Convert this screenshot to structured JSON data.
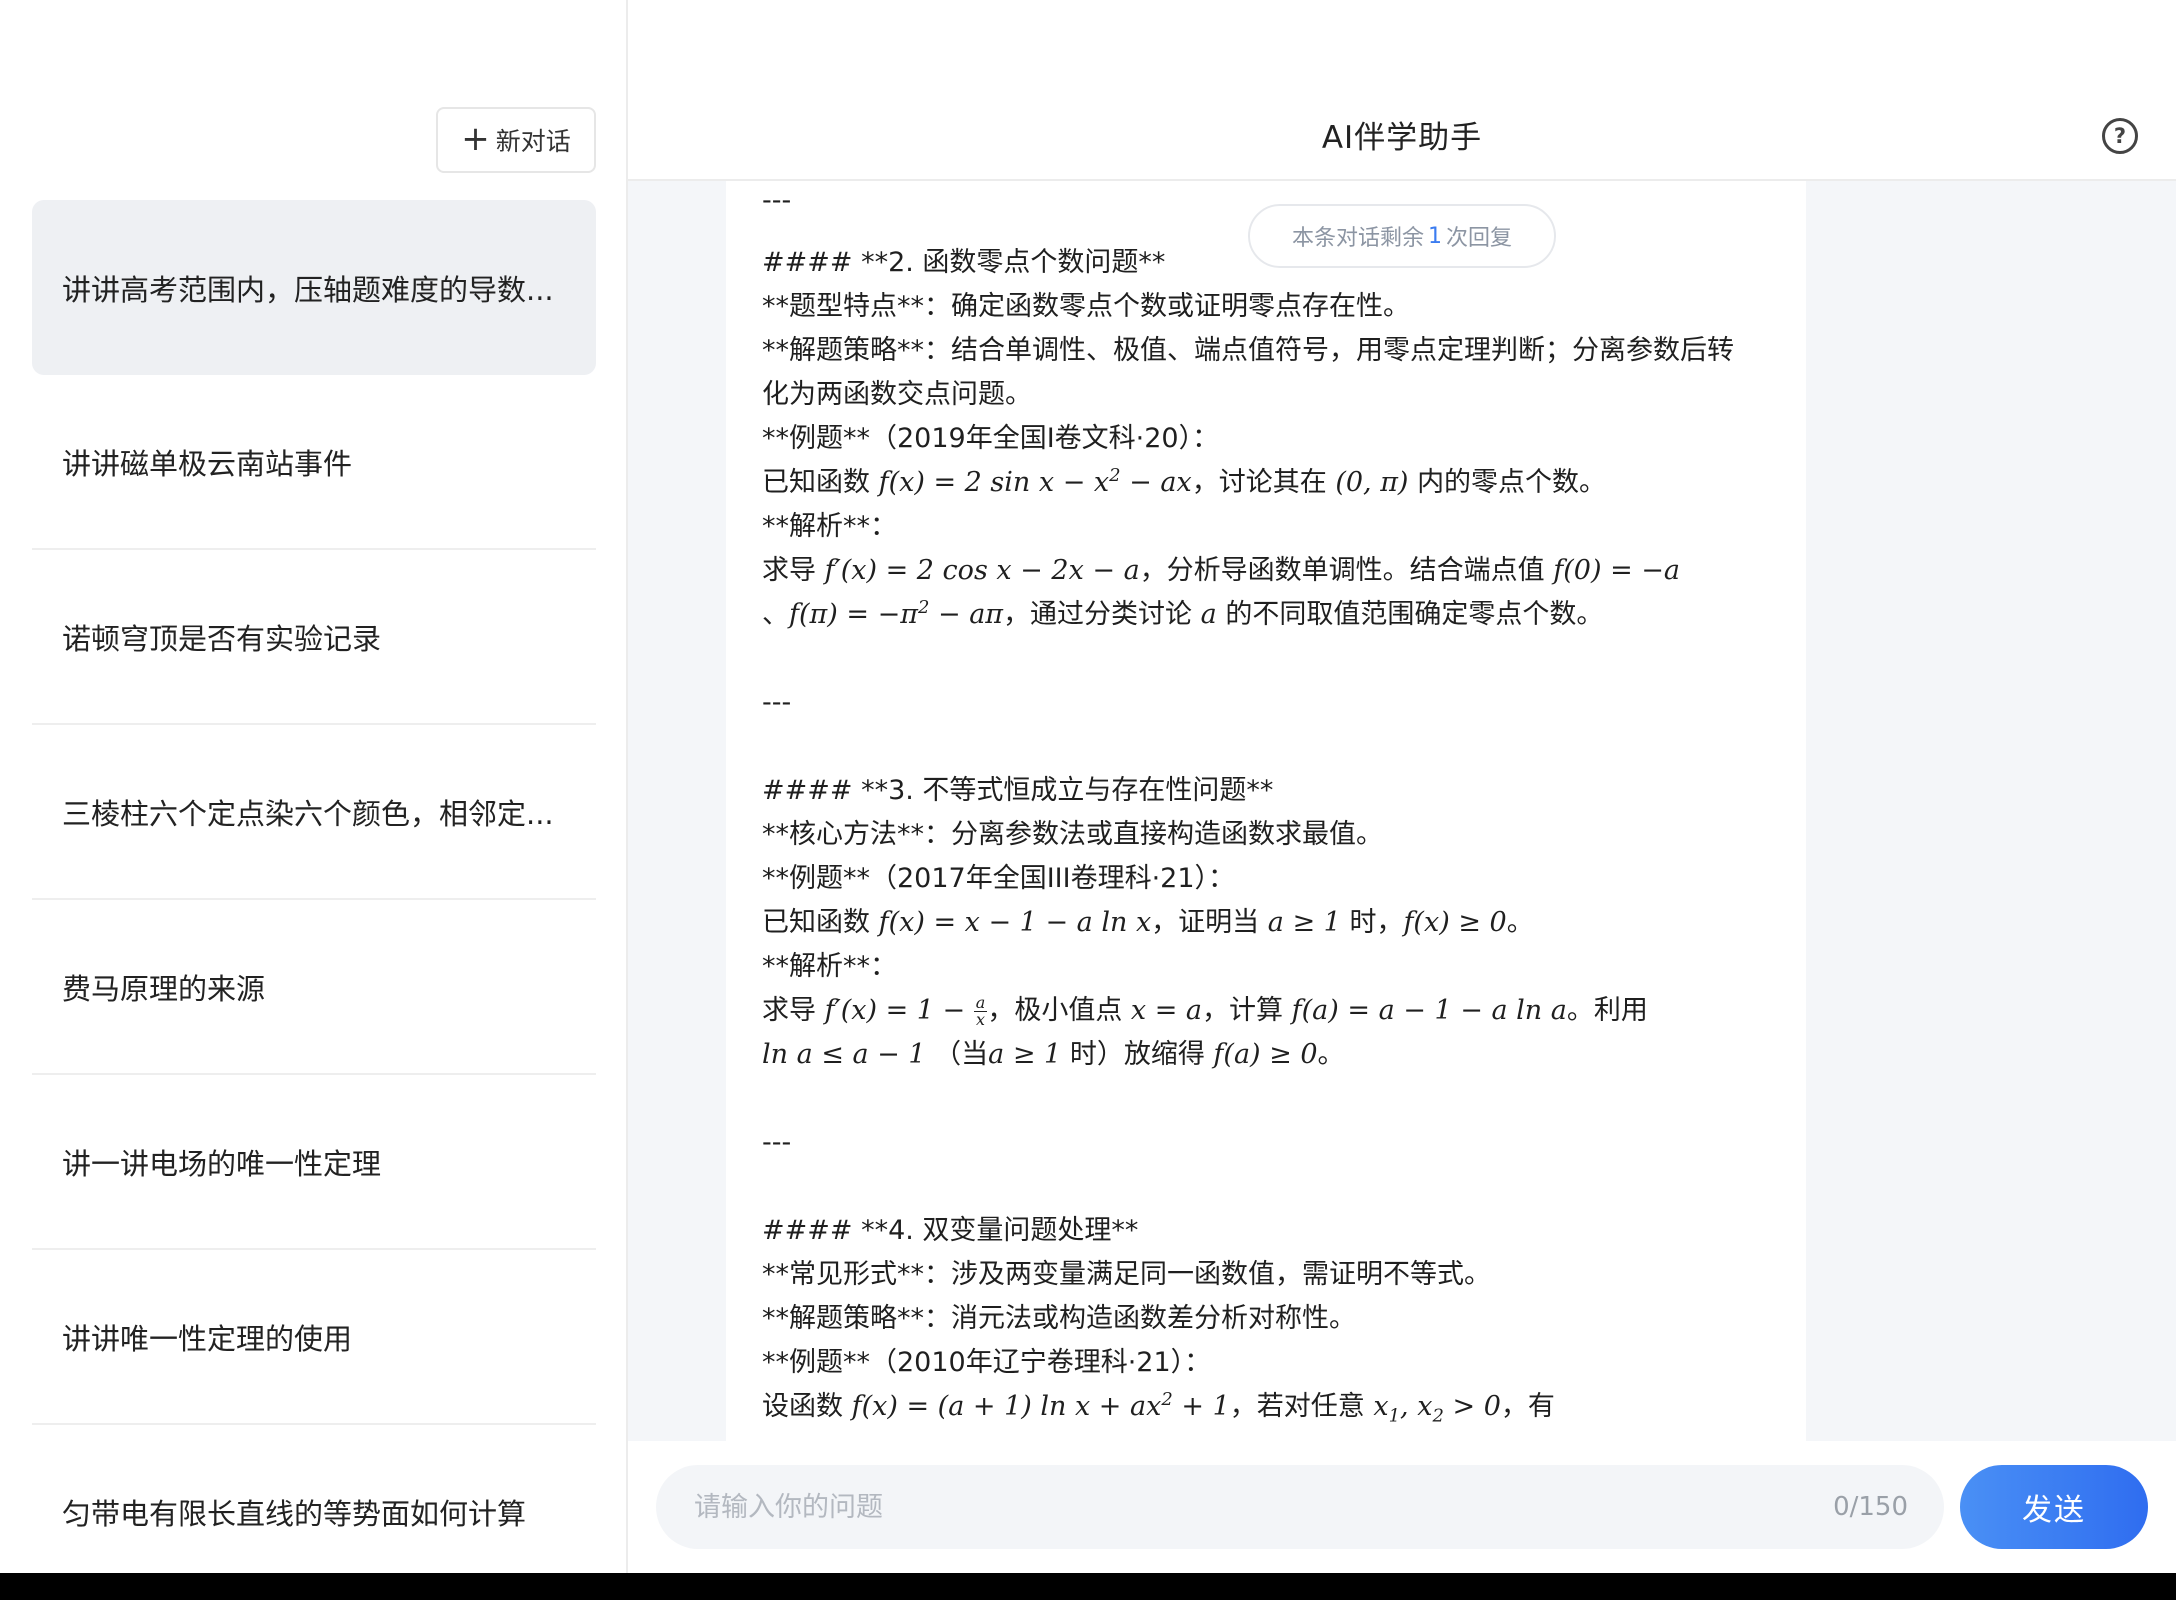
{
  "app": {
    "title": "AI伴学助手"
  },
  "sidebar": {
    "new_chat_label": "新对话",
    "items": [
      {
        "label": "讲讲高考范围内，压轴题难度的导数..."
      },
      {
        "label": "讲讲磁单极云南站事件"
      },
      {
        "label": "诺顿穹顶是否有实验记录"
      },
      {
        "label": "三棱柱六个定点染六个颜色，相邻定..."
      },
      {
        "label": "费马原理的来源"
      },
      {
        "label": "讲一讲电场的唯一性定理"
      },
      {
        "label": "讲讲唯一性定理的使用"
      },
      {
        "label": "匀带电有限长直线的等势面如何计算"
      }
    ]
  },
  "chat": {
    "remaining_prefix": "本条对话剩余",
    "remaining_count": "1",
    "remaining_suffix": "次回复",
    "lines": {
      "l0": "---",
      "l1": "#### **2. 函数零点个数问题**",
      "l2": "**题型特点**：确定函数零点个数或证明零点存在性。",
      "l3": "**解题策略**：结合单调性、极值、端点值符号，用零点定理判断；分离参数后转",
      "l4": "化为两函数交点问题。",
      "l5": "**例题**（2019年全国I卷文科·20）：",
      "l6a": "已知函数",
      "l6b": "，讨论其在",
      "l6c": "内的零点个数。",
      "l7": "**解析**：",
      "l8a": "求导",
      "l8b": "，分析导函数单调性。结合端点值",
      "l9a": "、",
      "l9b": "，通过分类讨论",
      "l9c": "的不同取值范围确定零点个数。",
      "l10": "---",
      "l11": "#### **3. 不等式恒成立与存在性问题**",
      "l12": "**核心方法**：分离参数法或直接构造函数求最值。",
      "l13": "**例题**（2017年全国III卷理科·21）：",
      "l14a": "已知函数",
      "l14b": "，证明当",
      "l14c": "时，",
      "l14d": "。",
      "l15": "**解析**：",
      "l16a": "求导",
      "l16b": "，极小值点",
      "l16c": "，计算",
      "l16d": "。利用",
      "l17a": "（当",
      "l17b": "时）放缩得",
      "l17c": "。",
      "l18": "---",
      "l19": "#### **4. 双变量问题处理**",
      "l20": "**常见形式**：涉及两变量满足同一函数值，需证明不等式。",
      "l21": "**解题策略**：消元法或构造函数差分析对称性。",
      "l22": "**例题**（2010年辽宁卷理科·21）：",
      "l23a": "设函数",
      "l23b": "，若对任意",
      "l23c": "，有"
    }
  },
  "footer": {
    "placeholder": "请输入你的问题",
    "counter": "0/150",
    "send_label": "发送"
  }
}
